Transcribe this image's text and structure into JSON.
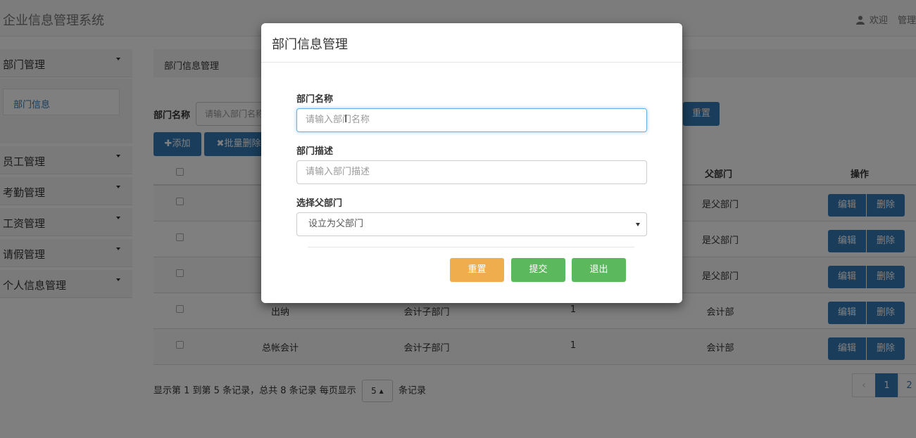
{
  "app": {
    "title": "企业信息管理系统",
    "welcome": "欢迎",
    "admin_label": "管理"
  },
  "sidebar": {
    "items": [
      {
        "label": "部门管理"
      },
      {
        "label": "员工管理"
      },
      {
        "label": "考勤管理"
      },
      {
        "label": "工资管理"
      },
      {
        "label": "请假管理"
      },
      {
        "label": "个人信息管理"
      }
    ],
    "submenu": [
      {
        "label": "部门信息"
      }
    ]
  },
  "main": {
    "breadcrumb": "部门信息管理",
    "search": {
      "label": "部门名称",
      "placeholder": "请输入部门名称",
      "reset_label": "重置"
    },
    "toolbar": {
      "add_label": "✚添加",
      "batch_delete_label": "✖批量删除"
    },
    "table": {
      "headers": {
        "parent": "父部门",
        "actions": "操作"
      },
      "rows": [
        {
          "name": "",
          "desc": "",
          "level": "",
          "parent": "是父部门"
        },
        {
          "name": "",
          "desc": "",
          "level": "",
          "parent": "是父部门"
        },
        {
          "name": "",
          "desc": "",
          "level": "",
          "parent": "是父部门"
        },
        {
          "name": "出纳",
          "desc": "会计子部门",
          "level": "1",
          "parent": "会计部"
        },
        {
          "name": "总帐会计",
          "desc": "会计子部门",
          "level": "1",
          "parent": "会计部"
        }
      ],
      "edit_label": "编辑",
      "delete_label": "删除"
    },
    "pager": {
      "info_prefix": "显示第 1 到第 5 条记录，总共 8 条记录 每页显示",
      "page_size": "5 ▴",
      "info_suffix": "条记录",
      "prev_label": "‹",
      "pages": [
        "1",
        "2"
      ]
    }
  },
  "modal": {
    "title": "部门信息管理",
    "fields": {
      "name_label": "部门名称",
      "name_placeholder": "请输入部门名称",
      "desc_label": "部门描述",
      "desc_placeholder": "请输入部门描述",
      "parent_label": "选择父部门",
      "parent_selected": "设立为父部门"
    },
    "buttons": {
      "reset": "重置",
      "submit": "提交",
      "exit": "退出"
    }
  },
  "colors": {
    "primary": "#337ab7",
    "warning": "#f0ad4e",
    "success": "#5cb85c",
    "focus": "#66afe9"
  }
}
